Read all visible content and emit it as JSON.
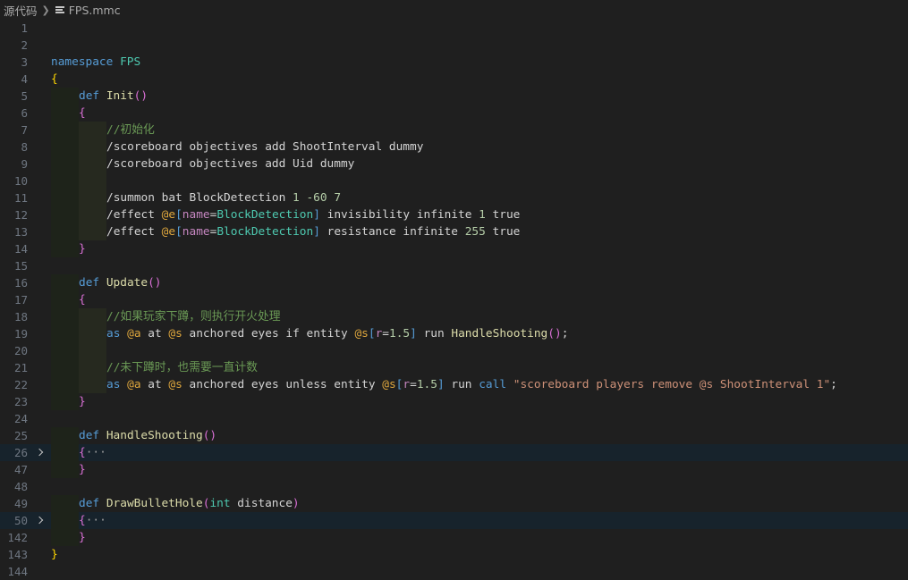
{
  "breadcrumb": {
    "folder": "源代码",
    "file": "FPS.mmc"
  },
  "colors": {
    "keyword": "#569cd6",
    "namespace": "#4ec9b0",
    "function": "#dcdcaa",
    "text": "#d4d4d4",
    "comment": "#6a9955",
    "number": "#b5cea8",
    "selector": "#dfa73d",
    "attr": "#c586c0",
    "attr_value": "#4ec9b0",
    "bracket": "#569cd6",
    "string": "#ce9178",
    "brace1": "#ffd700",
    "brace2": "#da70d6",
    "fold_ellipsis": "#a0a0a0"
  },
  "lines": [
    {
      "n": "1",
      "indent": 0,
      "tokens": []
    },
    {
      "n": "2",
      "indent": 0,
      "tokens": []
    },
    {
      "n": "3",
      "indent": 0,
      "tokens": [
        [
          "namespace",
          "keyword"
        ],
        [
          " ",
          "text"
        ],
        [
          "FPS",
          "namespace"
        ]
      ]
    },
    {
      "n": "4",
      "indent": 0,
      "tokens": [
        [
          "{",
          "brace1"
        ]
      ]
    },
    {
      "n": "5",
      "indent": 1,
      "tokens": [
        [
          "def",
          "keyword"
        ],
        [
          " ",
          "text"
        ],
        [
          "Init",
          "function"
        ],
        [
          "()",
          "brace2"
        ]
      ]
    },
    {
      "n": "6",
      "indent": 1,
      "tokens": [
        [
          "{",
          "brace2"
        ]
      ]
    },
    {
      "n": "7",
      "indent": 2,
      "tokens": [
        [
          "//初始化",
          "comment"
        ]
      ]
    },
    {
      "n": "8",
      "indent": 2,
      "tokens": [
        [
          "/scoreboard objectives add ShootInterval dummy",
          "text"
        ]
      ]
    },
    {
      "n": "9",
      "indent": 2,
      "tokens": [
        [
          "/scoreboard objectives add Uid dummy",
          "text"
        ]
      ]
    },
    {
      "n": "10",
      "indent": 2,
      "tokens": []
    },
    {
      "n": "11",
      "indent": 2,
      "tokens": [
        [
          "/summon bat BlockDetection ",
          "text"
        ],
        [
          "1",
          "number"
        ],
        [
          " ",
          "text"
        ],
        [
          "-60",
          "number"
        ],
        [
          " ",
          "text"
        ],
        [
          "7",
          "number"
        ]
      ]
    },
    {
      "n": "12",
      "indent": 2,
      "tokens": [
        [
          "/effect ",
          "text"
        ],
        [
          "@e",
          "selector"
        ],
        [
          "[",
          "bracket"
        ],
        [
          "name",
          "attr"
        ],
        [
          "=",
          "text"
        ],
        [
          "BlockDetection",
          "attr_value"
        ],
        [
          "]",
          "bracket"
        ],
        [
          " invisibility infinite ",
          "text"
        ],
        [
          "1",
          "number"
        ],
        [
          " true",
          "text"
        ]
      ]
    },
    {
      "n": "13",
      "indent": 2,
      "tokens": [
        [
          "/effect ",
          "text"
        ],
        [
          "@e",
          "selector"
        ],
        [
          "[",
          "bracket"
        ],
        [
          "name",
          "attr"
        ],
        [
          "=",
          "text"
        ],
        [
          "BlockDetection",
          "attr_value"
        ],
        [
          "]",
          "bracket"
        ],
        [
          " resistance infinite ",
          "text"
        ],
        [
          "255",
          "number"
        ],
        [
          " true",
          "text"
        ]
      ]
    },
    {
      "n": "14",
      "indent": 1,
      "tokens": [
        [
          "}",
          "brace2"
        ]
      ]
    },
    {
      "n": "15",
      "indent": 0,
      "tokens": []
    },
    {
      "n": "16",
      "indent": 1,
      "tokens": [
        [
          "def",
          "keyword"
        ],
        [
          " ",
          "text"
        ],
        [
          "Update",
          "function"
        ],
        [
          "()",
          "brace2"
        ]
      ]
    },
    {
      "n": "17",
      "indent": 1,
      "tokens": [
        [
          "{",
          "brace2"
        ]
      ]
    },
    {
      "n": "18",
      "indent": 2,
      "tokens": [
        [
          "//如果玩家下蹲，则执行开火处理",
          "comment"
        ]
      ]
    },
    {
      "n": "19",
      "indent": 2,
      "tokens": [
        [
          "as",
          "keyword"
        ],
        [
          " ",
          "text"
        ],
        [
          "@a",
          "selector"
        ],
        [
          " at ",
          "text"
        ],
        [
          "@s",
          "selector"
        ],
        [
          " anchored eyes if entity ",
          "text"
        ],
        [
          "@s",
          "selector"
        ],
        [
          "[",
          "bracket"
        ],
        [
          "r",
          "attr"
        ],
        [
          "=",
          "text"
        ],
        [
          "1.5",
          "number"
        ],
        [
          "]",
          "bracket"
        ],
        [
          " run ",
          "text"
        ],
        [
          "HandleShooting",
          "function"
        ],
        [
          "()",
          "brace2"
        ],
        [
          ";",
          "text"
        ]
      ]
    },
    {
      "n": "20",
      "indent": 2,
      "tokens": []
    },
    {
      "n": "21",
      "indent": 2,
      "tokens": [
        [
          "//未下蹲时，也需要一直计数",
          "comment"
        ]
      ]
    },
    {
      "n": "22",
      "indent": 2,
      "tokens": [
        [
          "as",
          "keyword"
        ],
        [
          " ",
          "text"
        ],
        [
          "@a",
          "selector"
        ],
        [
          " at ",
          "text"
        ],
        [
          "@s",
          "selector"
        ],
        [
          " anchored eyes unless entity ",
          "text"
        ],
        [
          "@s",
          "selector"
        ],
        [
          "[",
          "bracket"
        ],
        [
          "r",
          "attr"
        ],
        [
          "=",
          "text"
        ],
        [
          "1.5",
          "number"
        ],
        [
          "]",
          "bracket"
        ],
        [
          " run ",
          "text"
        ],
        [
          "call",
          "keyword"
        ],
        [
          " ",
          "text"
        ],
        [
          "\"scoreboard players remove @s ShootInterval 1\"",
          "string"
        ],
        [
          ";",
          "text"
        ]
      ]
    },
    {
      "n": "23",
      "indent": 1,
      "tokens": [
        [
          "}",
          "brace2"
        ]
      ]
    },
    {
      "n": "24",
      "indent": 0,
      "tokens": []
    },
    {
      "n": "25",
      "indent": 1,
      "tokens": [
        [
          "def",
          "keyword"
        ],
        [
          " ",
          "text"
        ],
        [
          "HandleShooting",
          "function"
        ],
        [
          "()",
          "brace2"
        ]
      ]
    },
    {
      "n": "26",
      "indent": 1,
      "folded": true,
      "highlighted": true,
      "tokens": [
        [
          "{",
          "brace2"
        ],
        [
          "···",
          "fold_ellipsis"
        ]
      ]
    },
    {
      "n": "47",
      "indent": 1,
      "tokens": [
        [
          "}",
          "brace2"
        ]
      ]
    },
    {
      "n": "48",
      "indent": 0,
      "tokens": []
    },
    {
      "n": "49",
      "indent": 1,
      "tokens": [
        [
          "def",
          "keyword"
        ],
        [
          " ",
          "text"
        ],
        [
          "DrawBulletHole",
          "function"
        ],
        [
          "(",
          "brace2"
        ],
        [
          "int",
          "namespace"
        ],
        [
          " ",
          "text"
        ],
        [
          "distance",
          "text"
        ],
        [
          ")",
          "brace2"
        ]
      ]
    },
    {
      "n": "50",
      "indent": 1,
      "folded": true,
      "highlighted": true,
      "tokens": [
        [
          "{",
          "brace2"
        ],
        [
          "···",
          "fold_ellipsis"
        ]
      ]
    },
    {
      "n": "142",
      "indent": 1,
      "tokens": [
        [
          "}",
          "brace2"
        ]
      ]
    },
    {
      "n": "143",
      "indent": 0,
      "tokens": [
        [
          "}",
          "brace1"
        ]
      ]
    },
    {
      "n": "144",
      "indent": 0,
      "tokens": []
    }
  ]
}
